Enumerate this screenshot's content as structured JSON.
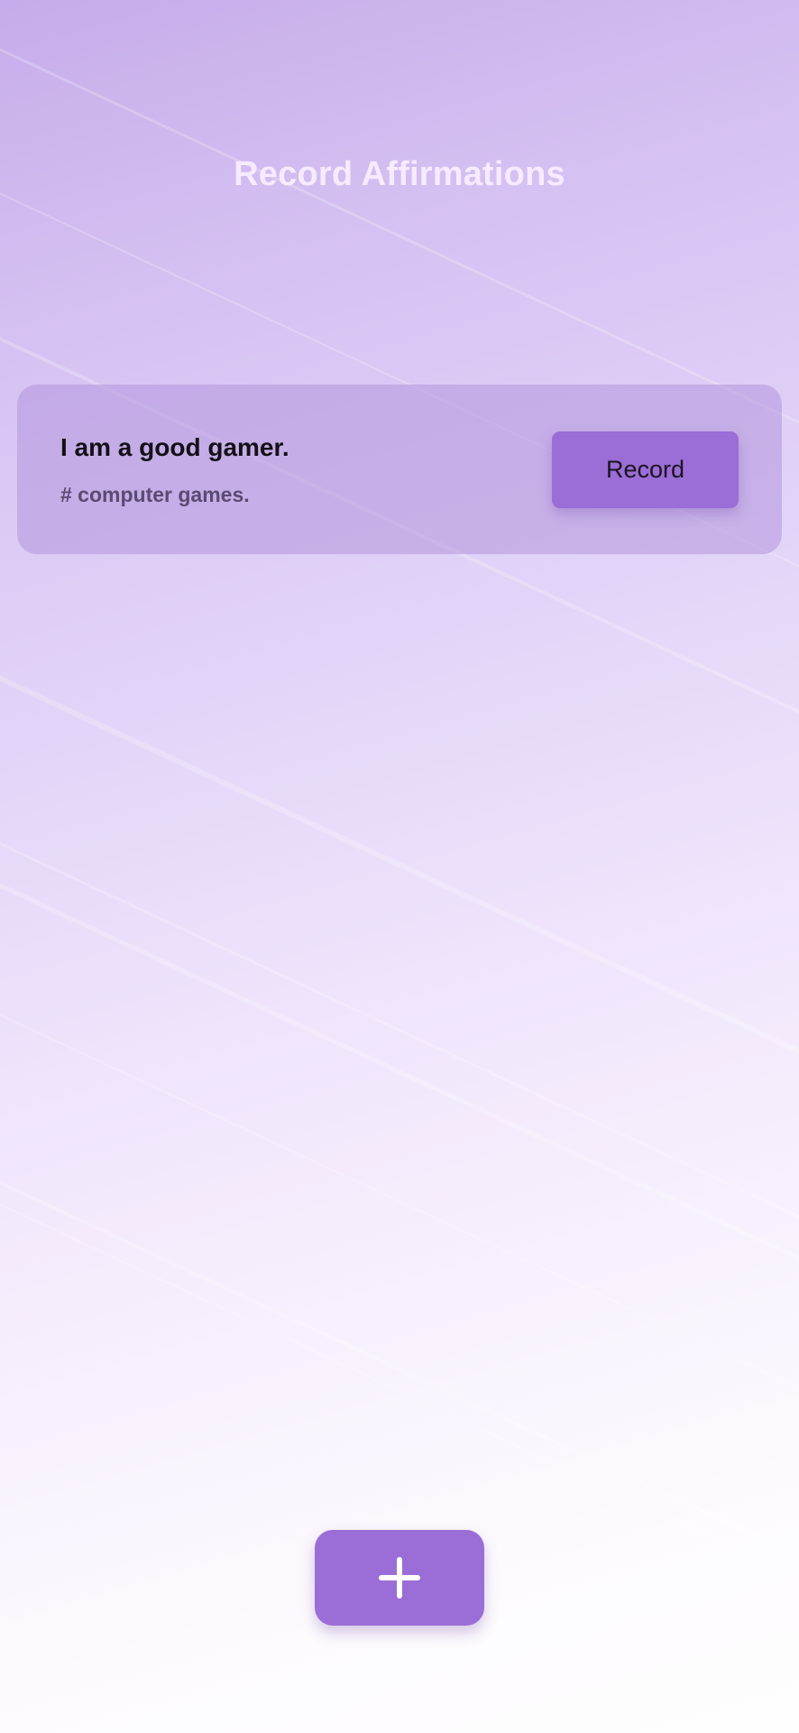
{
  "header": {
    "title": "Record Affirmations"
  },
  "affirmations": [
    {
      "text": "I am a good gamer.",
      "tag": "# computer games.",
      "record_label": "Record"
    }
  ],
  "fab": {
    "icon": "plus-icon"
  },
  "colors": {
    "accent": "#9b6dd6",
    "card_background": "#c3a9e3",
    "title": "#f6ebff"
  }
}
